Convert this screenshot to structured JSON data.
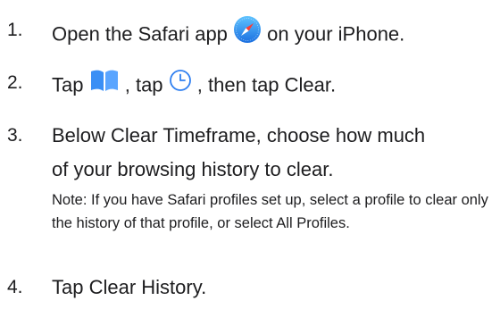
{
  "steps": [
    {
      "number": "1.",
      "before": "Open the Safari app",
      "after": "on your iPhone.",
      "icon": "safari-compass-icon"
    },
    {
      "number": "2.",
      "part1": "Tap",
      "icon1": "bookmarks-book-icon",
      "part2": ", tap",
      "icon2": "clock-history-icon",
      "part3": ", then tap Clear."
    },
    {
      "number": "3.",
      "line1": "Below Clear Timeframe, choose how much",
      "line2": "of your browsing history to clear.",
      "note": "Note: If you have Safari profiles set up, select a profile to clear only the history of that profile, or select All Profiles."
    },
    {
      "number": "4.",
      "text": "Tap Clear History."
    }
  ],
  "colors": {
    "text": "#1d1d1f",
    "safari_blue": "#1e88f0",
    "book_blue": "#3a8ff5",
    "clock_blue": "#2f7ff0"
  }
}
